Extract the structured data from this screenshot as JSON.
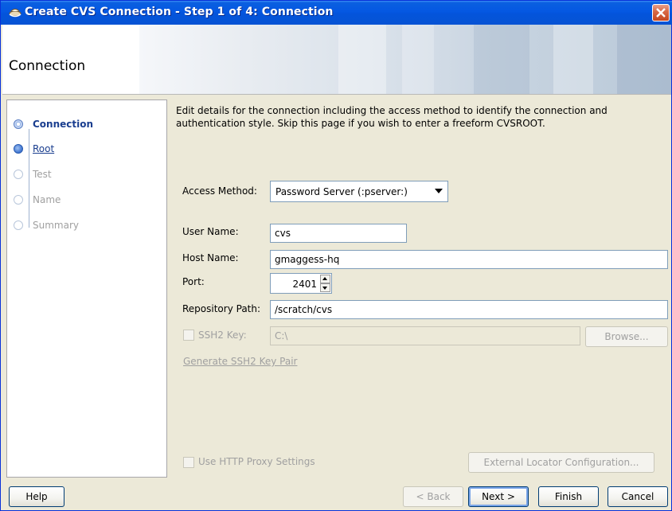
{
  "window": {
    "title": "Create CVS Connection - Step 1 of 4: Connection"
  },
  "header": {
    "title": "Connection"
  },
  "train": {
    "items": [
      {
        "label": "Connection",
        "state": "current"
      },
      {
        "label": "Root",
        "state": "next"
      },
      {
        "label": "Test",
        "state": "disabled"
      },
      {
        "label": "Name",
        "state": "disabled"
      },
      {
        "label": "Summary",
        "state": "disabled"
      }
    ]
  },
  "main": {
    "description": "Edit details for the connection including the access method to identify the connection and authentication style. Skip this page if you wish to enter a freeform CVSROOT.",
    "access_method": {
      "label": "Access Method:",
      "value": "Password Server (:pserver:)"
    },
    "user_name": {
      "label": "User Name:",
      "value": "cvs"
    },
    "host_name": {
      "label": "Host Name:",
      "value": "gmaggess-hq"
    },
    "port": {
      "label": "Port:",
      "value": "2401"
    },
    "repository_path": {
      "label": "Repository Path:",
      "value": "/scratch/cvs"
    },
    "ssh2_key": {
      "label": "SSH2 Key:",
      "value": "C:\\",
      "checked": false,
      "browse_label": "Browse..."
    },
    "generate_link": "Generate SSH2 Key Pair",
    "http_proxy": {
      "label": "Use HTTP Proxy Settings",
      "checked": false
    },
    "external_locator_label": "External Locator Configuration..."
  },
  "footer": {
    "help_label": "Help",
    "back_label": "< Back",
    "next_label": "Next >",
    "finish_label": "Finish",
    "cancel_label": "Cancel"
  },
  "colors": {
    "titlebar": "#0558e2",
    "train_current": "#1a3e8f",
    "disabled_text": "#a0a0a0"
  }
}
